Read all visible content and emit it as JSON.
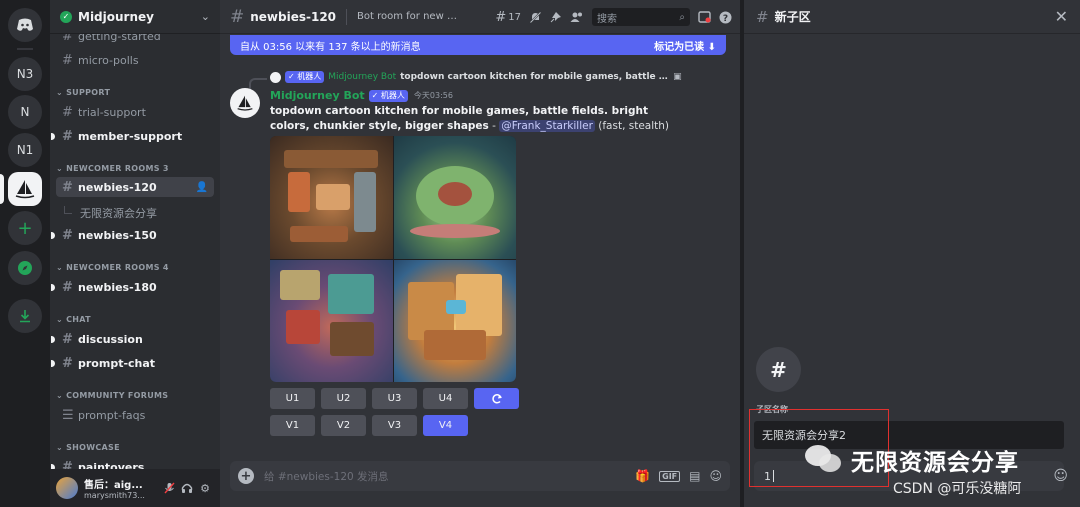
{
  "rail": {
    "servers": [
      {
        "label": "N3"
      },
      {
        "label": "N"
      },
      {
        "label": "N1"
      }
    ]
  },
  "guild": {
    "name": "Midjourney"
  },
  "sidebar": {
    "channels_top": [
      {
        "name": "getting-started"
      },
      {
        "name": "micro-polls"
      }
    ],
    "cat_support": "SUPPORT",
    "support": [
      {
        "name": "trial-support"
      },
      {
        "name": "member-support"
      }
    ],
    "cat_newcomer3": "NEWCOMER ROOMS 3",
    "newcomer3": [
      {
        "name": "newbies-120"
      },
      {
        "name": "newbies-150"
      }
    ],
    "thread_item": "无限资源会分享",
    "cat_newcomer4": "NEWCOMER ROOMS 4",
    "newcomer4": [
      {
        "name": "newbies-180"
      }
    ],
    "cat_chat": "CHAT",
    "chat": [
      {
        "name": "discussion"
      },
      {
        "name": "prompt-chat"
      }
    ],
    "cat_forums": "COMMUNITY FORUMS",
    "forums": [
      {
        "name": "prompt-faqs"
      }
    ],
    "cat_showcase": "SHOWCASE",
    "showcase": [
      {
        "name": "paintovers"
      }
    ]
  },
  "user": {
    "name": "售后：aig...",
    "tag": "marysmith73..."
  },
  "topbar": {
    "channel": "newbies-120",
    "topic": "Bot room for new use...",
    "threads_count": "17",
    "search_placeholder": "搜索"
  },
  "banner": {
    "text": "自从 03:56 以来有 137 条以上的新消息",
    "action": "标记为已读"
  },
  "reply": {
    "tag": "✓ 机器人",
    "name": "Midjourney Bot",
    "text": "topdown cartoon kitchen for mobile games, battle fields. bright c"
  },
  "message": {
    "author": "Midjourney Bot",
    "tag": "✓ 机器人",
    "time": "今天03:56",
    "prompt": "topdown cartoon kitchen for mobile games, battle fields. bright colors, chunkier style, bigger shapes",
    "sep": " - ",
    "mention": "@Frank_Starkiller",
    "suffix": " (fast, stealth)"
  },
  "buttons": {
    "upscale": [
      "U1",
      "U2",
      "U3",
      "U4"
    ],
    "variation": [
      "V1",
      "V2",
      "V3",
      "V4"
    ],
    "reroll_icon": "refresh-icon"
  },
  "composer": {
    "placeholder": "给 #newbies-120 发消息"
  },
  "thread_panel": {
    "title": "新子区",
    "label": "子区名称",
    "name_value": "无限资源会分享2",
    "message_value": "1"
  },
  "watermark": {
    "main": "无限资源会分享",
    "csdn": "CSDN @可乐没糖阿"
  },
  "colors": {
    "accent": "#5865f2",
    "bot_green": "#23a559",
    "highlight_red": "#e0312f"
  }
}
